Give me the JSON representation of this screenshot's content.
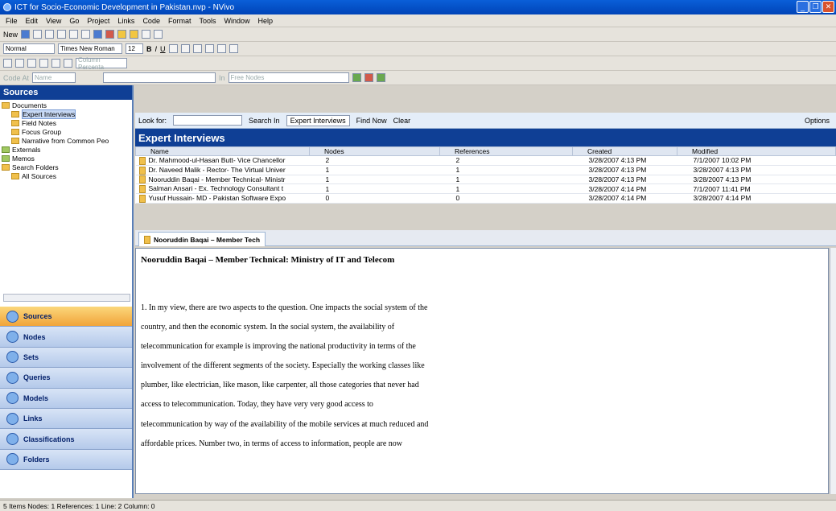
{
  "window": {
    "title": "ICT for Socio-Economic Development in Pakistan.nvp - NVivo"
  },
  "menu": [
    "File",
    "Edit",
    "View",
    "Go",
    "Project",
    "Links",
    "Code",
    "Format",
    "Tools",
    "Window",
    "Help"
  ],
  "toolbar": {
    "new_label": "New",
    "style_value": "Normal",
    "font_value": "Times New Roman",
    "size_value": "12",
    "column_percent": "Column Percenta",
    "code_at": "Code At",
    "name_label": "Name",
    "in_label": "In",
    "free_nodes": "Free Nodes"
  },
  "sources": {
    "header": "Sources",
    "tree": [
      {
        "label": "Documents",
        "indent": 0
      },
      {
        "label": "Expert Interviews",
        "indent": 1,
        "selected": true
      },
      {
        "label": "Field Notes",
        "indent": 1
      },
      {
        "label": "Focus Group",
        "indent": 1
      },
      {
        "label": "Narrative from Common Peo",
        "indent": 1
      },
      {
        "label": "Externals",
        "indent": 0
      },
      {
        "label": "Memos",
        "indent": 0
      },
      {
        "label": "Search Folders",
        "indent": 0
      },
      {
        "label": "All Sources",
        "indent": 1
      }
    ]
  },
  "nav": [
    "Sources",
    "Nodes",
    "Sets",
    "Queries",
    "Models",
    "Links",
    "Classifications",
    "Folders"
  ],
  "lookfor": {
    "label": "Look for:",
    "search_in": "Search In",
    "scope": "Expert Interviews",
    "find_now": "Find Now",
    "clear": "Clear",
    "options": "Options"
  },
  "list": {
    "title": "Expert Interviews",
    "columns": [
      "Name",
      "Nodes",
      "References",
      "Created",
      "Modified"
    ],
    "rows": [
      [
        "Dr. Mahmood-ul-Hasan Butt- Vice Chancellor",
        "2",
        "2",
        "3/28/2007 4:13 PM",
        "7/1/2007 10:02 PM"
      ],
      [
        "Dr. Naveed Malik - Rector- The Virtual Univer",
        "1",
        "1",
        "3/28/2007 4:13 PM",
        "3/28/2007 4:13 PM"
      ],
      [
        "Nooruddin Baqai - Member Technical- Ministr",
        "1",
        "1",
        "3/28/2007 4:13 PM",
        "3/28/2007 4:13 PM"
      ],
      [
        "Salman Ansari - Ex. Technology Consultant t",
        "1",
        "1",
        "3/28/2007 4:14 PM",
        "7/1/2007 11:41 PM"
      ],
      [
        "Yusuf Hussain- MD - Pakistan Software Expo",
        "0",
        "0",
        "3/28/2007 4:14 PM",
        "3/28/2007 4:14 PM"
      ]
    ]
  },
  "doc": {
    "tab": "Nooruddin Baqai – Member Tech",
    "heading": "Nooruddin Baqai – Member Technical: Ministry of IT and Telecom",
    "lines": [
      "1. In my view, there are two aspects to the question. One impacts the social system of the",
      "country, and then the economic system. In the social system, the availability of",
      "telecommunication for example is improving the national productivity in terms of the",
      "involvement  of the different segments of the society. Especially the working classes like",
      "plumber, like electrician, like mason, like carpenter, all those categories that never had",
      "access to telecommunication. Today, they have very very good access to",
      "telecommunication by way of the availability of the mobile services at much reduced  and",
      "affordable prices. Number two, in terms of access to information, people are now"
    ]
  },
  "status": "5 Items  Nodes: 1  References: 1  Line: 2 Column: 0"
}
